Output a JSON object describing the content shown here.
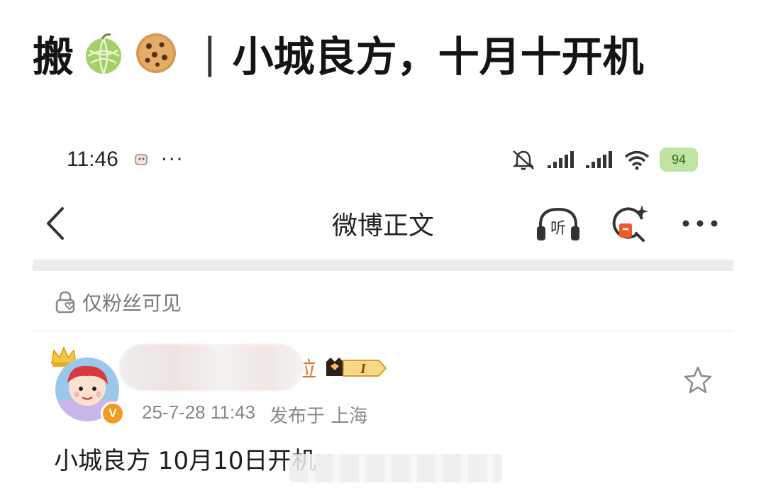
{
  "headline": {
    "prefix": "搬",
    "separator": "|",
    "text": "小城良方，十月十开机",
    "emojis": [
      "melon-icon",
      "cookie-icon"
    ]
  },
  "status_bar": {
    "time": "11:46",
    "more": "···",
    "battery": "94",
    "icons": [
      "mute-bell-icon",
      "signal-icon",
      "signal-icon",
      "wifi-icon",
      "battery-icon"
    ]
  },
  "navbar": {
    "title": "微博正文",
    "listen_label": "听",
    "icons": [
      "back-icon",
      "listen-icon",
      "ai-search-icon",
      "more-icon"
    ]
  },
  "post": {
    "visibility": "仅粉丝可见",
    "author_name_tail": "拉",
    "timestamp": "25-7-28 11:43",
    "location": "发布于 上海",
    "body": "小城良方 10月10日开机",
    "vip_level": "I"
  },
  "colors": {
    "accent_orange": "#e0742d",
    "verify_orange": "#f39b1f",
    "battery_green": "#bfe3a0"
  }
}
